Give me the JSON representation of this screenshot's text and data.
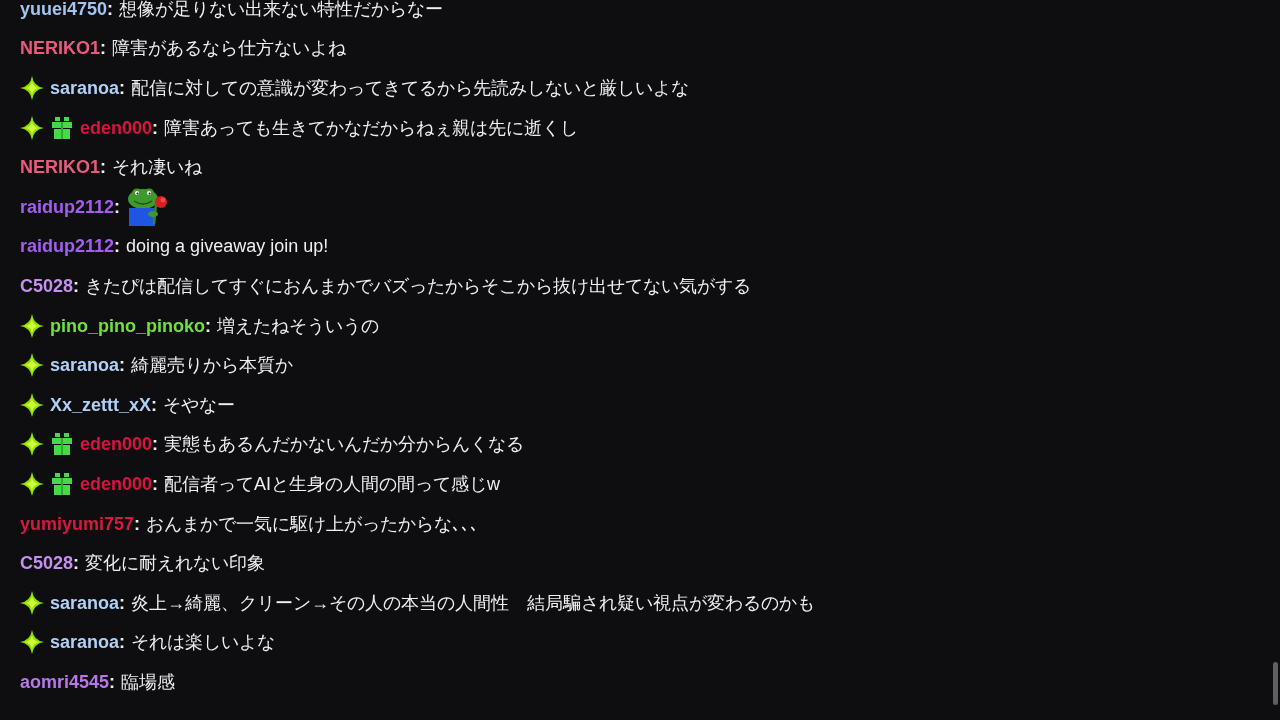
{
  "chat": {
    "messages": [
      {
        "user": "yuuei4750",
        "color": "#a3c4ef",
        "separator": ":",
        "kind": "text",
        "text": "想像が足りない出来ない特性だからなー"
      },
      {
        "user": "NERIKO1",
        "color": "#eb5a7d",
        "separator": ":",
        "kind": "text",
        "text": "障害があるなら仕方ないよね"
      },
      {
        "badges": [
          {
            "kind": "sparkle"
          }
        ],
        "user": "saranoa",
        "color": "#b0d0f5",
        "separator": ":",
        "kind": "text",
        "text": "配信に対しての意識が変わってきてるから先読みしないと厳しいよな"
      },
      {
        "badges": [
          {
            "kind": "sparkle"
          },
          {
            "kind": "gift"
          }
        ],
        "user": "eden000",
        "color": "#d8143f",
        "separator": ":",
        "kind": "text",
        "text": "障害あっても生きてかなだからねぇ親は先に逝くし"
      },
      {
        "user": "NERIKO1",
        "color": "#eb5a7d",
        "separator": ":",
        "kind": "text",
        "text": "それ凄いね"
      },
      {
        "user": "raidup2112",
        "color": "#a55cf0",
        "separator": ":",
        "kind": "emote"
      },
      {
        "user": "raidup2112",
        "color": "#a55cf0",
        "separator": ":",
        "kind": "text",
        "text": "doing a giveaway join up!"
      },
      {
        "user": "C5028",
        "color": "#c590ef",
        "separator": ":",
        "kind": "text",
        "text": "きたぴは配信してすぐにおんまかでバズったからそこから抜け出せてない気がする"
      },
      {
        "badges": [
          {
            "kind": "sparkle"
          }
        ],
        "user": "pino_pino_pinoko",
        "color": "#6fe13c",
        "separator": ":",
        "kind": "text",
        "text": "増えたねそういうの"
      },
      {
        "badges": [
          {
            "kind": "sparkle"
          }
        ],
        "user": "saranoa",
        "color": "#b0d0f5",
        "separator": ":",
        "kind": "text",
        "text": "綺麗売りから本質か"
      },
      {
        "badges": [
          {
            "kind": "sparkle"
          }
        ],
        "user": "Xx_zettt_xX",
        "color": "#b0d0f5",
        "separator": ":",
        "kind": "text",
        "text": "そやなー"
      },
      {
        "badges": [
          {
            "kind": "sparkle"
          },
          {
            "kind": "gift"
          }
        ],
        "user": "eden000",
        "color": "#d8143f",
        "separator": ":",
        "kind": "text",
        "text": "実態もあるんだかないんだか分からんくなる"
      },
      {
        "badges": [
          {
            "kind": "sparkle"
          },
          {
            "kind": "gift"
          }
        ],
        "user": "eden000",
        "color": "#d8143f",
        "separator": ":",
        "kind": "text",
        "text": "配信者ってAIと生身の人間の間って感じw"
      },
      {
        "user": "yumiyumi757",
        "color": "#d41a40",
        "separator": ":",
        "kind": "text",
        "text": "おんまかで一気に駆け上がったからな､､､"
      },
      {
        "user": "C5028",
        "color": "#c590ef",
        "separator": ":",
        "kind": "text",
        "text": "変化に耐えれない印象"
      },
      {
        "badges": [
          {
            "kind": "sparkle"
          }
        ],
        "user": "saranoa",
        "color": "#b0d0f5",
        "separator": ":",
        "kind": "text",
        "text": "炎上→綺麗、クリーン→その人の本当の人間性　結局騙され疑い視点が変わるのかも"
      },
      {
        "badges": [
          {
            "kind": "sparkle"
          }
        ],
        "user": "saranoa",
        "color": "#b0d0f5",
        "separator": ":",
        "kind": "text",
        "text": "それは楽しいよな"
      },
      {
        "user": "aomri4545",
        "color": "#b877e8",
        "separator": ":",
        "kind": "text",
        "text": "臨場感"
      }
    ]
  }
}
